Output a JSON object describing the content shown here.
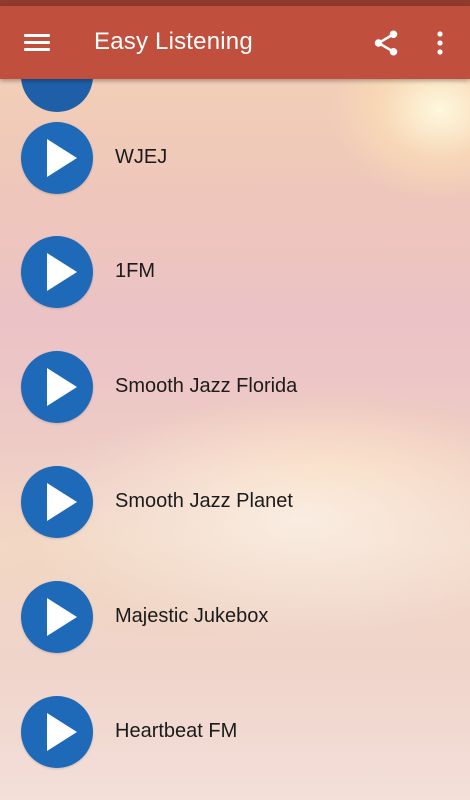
{
  "app": {
    "title": "Easy Listening"
  },
  "toolbar": {
    "menu_icon": "hamburger-menu-icon",
    "share_icon": "share-icon",
    "more_icon": "more-vert-icon"
  },
  "colors": {
    "appbar": "#c0503d",
    "statusbar": "#8f3a2c",
    "play_button": "#1e6ab8"
  },
  "stations": [
    {
      "name": "WJEJ"
    },
    {
      "name": "1FM"
    },
    {
      "name": "Smooth Jazz Florida"
    },
    {
      "name": "Smooth Jazz Planet"
    },
    {
      "name": "Majestic Jukebox"
    },
    {
      "name": "Heartbeat FM"
    }
  ]
}
